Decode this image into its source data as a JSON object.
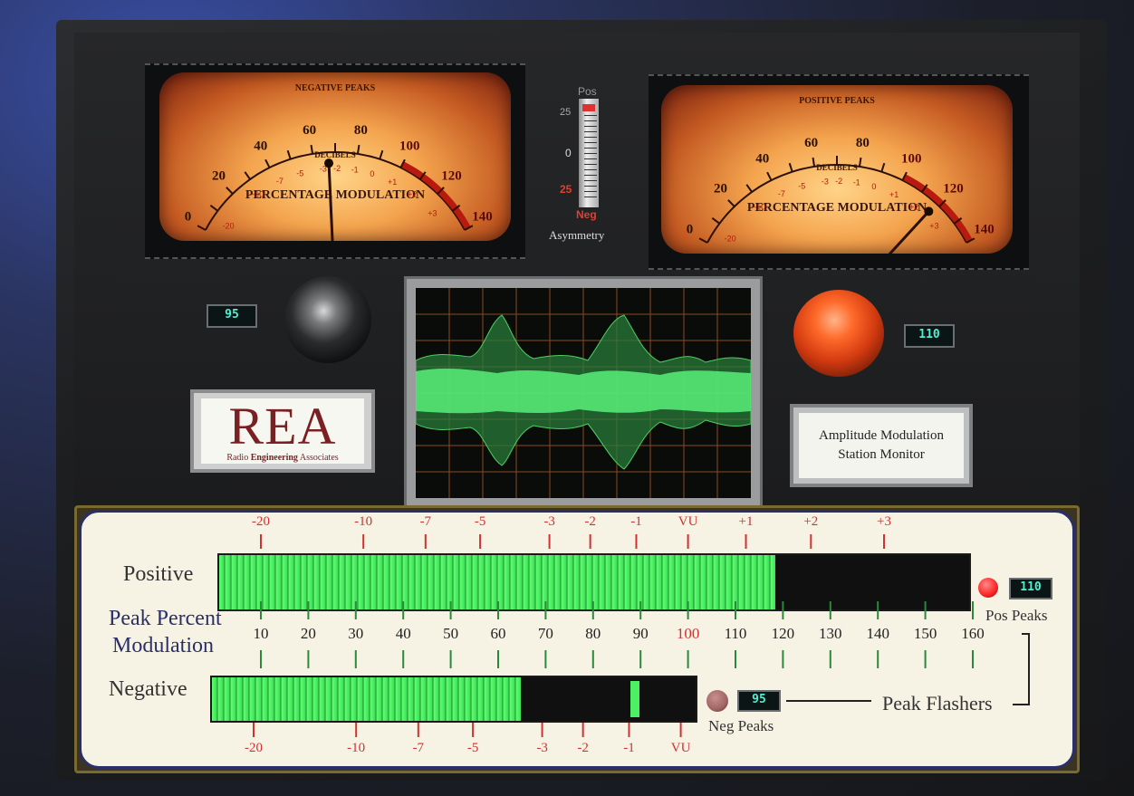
{
  "neg_meter": {
    "header": "NEGATIVE PEAKS",
    "scale": [
      "0",
      "20",
      "40",
      "60",
      "80",
      "100",
      "120",
      "140"
    ],
    "db_scale": [
      "-20",
      "-10",
      "-7",
      "-5",
      "-3",
      "-2",
      "-1",
      "0",
      "+1",
      "+2",
      "+3"
    ],
    "unit": "DECIBELS",
    "caption": "PERCENTAGE MODULATION",
    "needle_percent": 67
  },
  "pos_meter": {
    "header": "POSITIVE PEAKS",
    "scale": [
      "0",
      "20",
      "40",
      "60",
      "80",
      "100",
      "120",
      "140"
    ],
    "db_scale": [
      "-20",
      "-10",
      "-7",
      "-5",
      "-3",
      "-2",
      "-1",
      "0",
      "+1",
      "+2",
      "+3"
    ],
    "unit": "DECIBELS",
    "caption": "PERCENTAGE MODULATION",
    "needle_percent": 118
  },
  "asymmetry": {
    "top": "Pos",
    "upper": "25",
    "mid": "0",
    "lower": "25",
    "bottom": "Neg",
    "label": "Asymmetry"
  },
  "neg_readout": "95",
  "pos_readout": "110",
  "logo": {
    "letters": "REA",
    "tag_1": "Radio",
    "tag_2": "Engineering",
    "tag_3": "Associates"
  },
  "title": {
    "line1": "Amplitude Modulation",
    "line2": "Station Monitor"
  },
  "bars": {
    "positive_label": "Positive",
    "negative_label": "Negative",
    "mid_label_1": "Peak Percent",
    "mid_label_2": "Modulation",
    "percent_scale": [
      "10",
      "20",
      "30",
      "40",
      "50",
      "60",
      "70",
      "80",
      "90",
      "100",
      "110",
      "120",
      "130",
      "140",
      "150",
      "160"
    ],
    "top_db_scale": [
      "-20",
      "-10",
      "-7",
      "-5",
      "-3",
      "-2",
      "-1",
      "VU",
      "+1",
      "+2",
      "+3"
    ],
    "bottom_db_scale": [
      "-20",
      "-10",
      "-7",
      "-5",
      "-3",
      "-2",
      "-1",
      "VU"
    ],
    "positive_level_percent": 118,
    "negative_level_percent": 66,
    "negative_peak_percent": 89,
    "pos_peaks_label": "Pos Peaks",
    "neg_peaks_label": "Neg Peaks",
    "pos_peak_value": "110",
    "neg_peak_value": "95",
    "peak_flashers_label": "Peak Flashers"
  },
  "colors": {
    "bar_green": "#4cf063",
    "scale_red": "#d43030",
    "pos_led": "#ff2a2a",
    "neg_led": "#a06464"
  }
}
